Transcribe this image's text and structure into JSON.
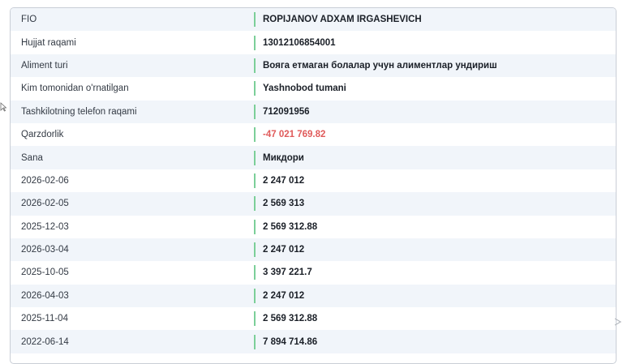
{
  "rows": [
    {
      "label": "FIO",
      "value": "ROPIJANOV ADXAM IRGASHEVICH",
      "status": "normal"
    },
    {
      "label": "Hujjat raqami",
      "value": "13012106854001",
      "status": "normal"
    },
    {
      "label": "Aliment turi",
      "value": "Вояга етмаган болалар учун алиментлар ундириш",
      "status": "normal"
    },
    {
      "label": "Kim tomonidan o'rnatilgan",
      "value": "Yashnobod tumani",
      "status": "normal"
    },
    {
      "label": "Tashkilotning telefon raqami",
      "value": "712091956",
      "status": "normal"
    },
    {
      "label": "Qarzdorlik",
      "value": "-47 021 769.82",
      "status": "negative"
    },
    {
      "label": "Sana",
      "value": "Микдори",
      "status": "normal"
    },
    {
      "label": "2026-02-06",
      "value": "2 247 012",
      "status": "normal"
    },
    {
      "label": "2026-02-05",
      "value": "2 569 313",
      "status": "normal"
    },
    {
      "label": "2025-12-03",
      "value": "2 569 312.88",
      "status": "normal"
    },
    {
      "label": "2026-03-04",
      "value": "2 247 012",
      "status": "normal"
    },
    {
      "label": "2025-10-05",
      "value": "3 397 221.7",
      "status": "normal"
    },
    {
      "label": "2026-04-03",
      "value": "2 247 012",
      "status": "normal"
    },
    {
      "label": "2025-11-04",
      "value": "2 569 312.88",
      "status": "normal"
    },
    {
      "label": "2022-06-14",
      "value": "7 894 714.86",
      "status": "normal"
    }
  ],
  "colors": {
    "accent_divider": "#7ccf99",
    "negative": "#e05a5a",
    "stripe": "#f1f5fa"
  }
}
